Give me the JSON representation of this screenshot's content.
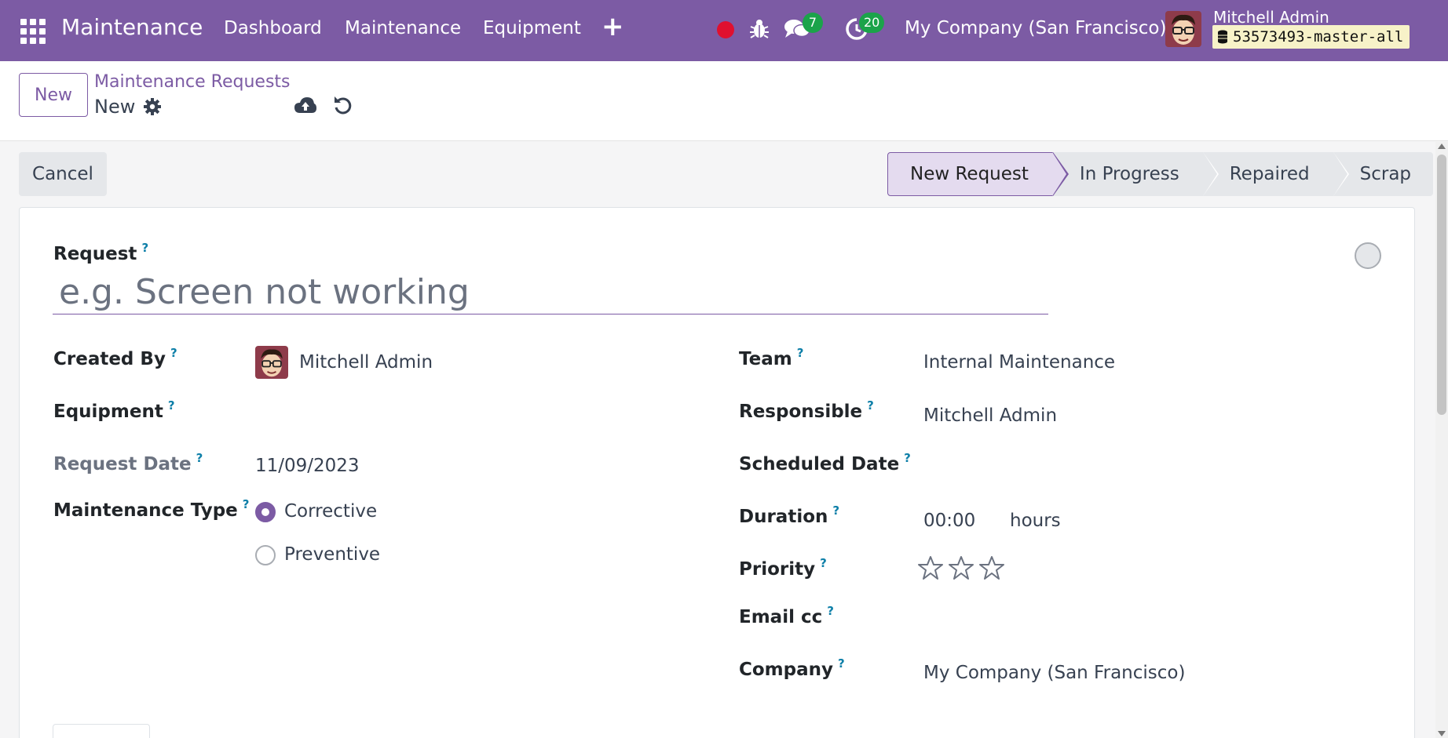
{
  "navbar": {
    "app_name": "Maintenance",
    "menu": [
      "Dashboard",
      "Maintenance",
      "Equipment"
    ],
    "messages_count": "7",
    "activities_count": "20",
    "company": "My Company (San Francisco)",
    "user_name": "Mitchell Admin",
    "database": "53573493-master-all"
  },
  "control_panel": {
    "new_label": "New",
    "breadcrumb_parent": "Maintenance Requests",
    "breadcrumb_current": "New"
  },
  "statusbar": {
    "cancel_label": "Cancel",
    "stages": [
      "New Request",
      "In Progress",
      "Repaired",
      "Scrap"
    ],
    "active_stage": "New Request"
  },
  "form": {
    "request_label": "Request",
    "request_placeholder": "e.g. Screen not working",
    "help_mark": "?",
    "created_by_label": "Created By",
    "created_by_value": "Mitchell Admin",
    "equipment_label": "Equipment",
    "equipment_value": "",
    "request_date_label": "Request Date",
    "request_date_value": "11/09/2023",
    "maintenance_type_label": "Maintenance Type",
    "maintenance_type_options": [
      "Corrective",
      "Preventive"
    ],
    "maintenance_type_selected": "Corrective",
    "team_label": "Team",
    "team_value": "Internal Maintenance",
    "responsible_label": "Responsible",
    "responsible_value": "Mitchell Admin",
    "scheduled_date_label": "Scheduled Date",
    "scheduled_date_value": "",
    "duration_label": "Duration",
    "duration_value": "00:00",
    "duration_unit": "hours",
    "priority_label": "Priority",
    "priority_stars_filled": 0,
    "priority_stars_total": 3,
    "email_cc_label": "Email cc",
    "email_cc_value": "",
    "company_label": "Company",
    "company_value": "My Company (San Francisco)"
  },
  "colors": {
    "brand": "#7c5ba4",
    "badge": "#1ba34a",
    "record_dot": "#e0102f",
    "help_mark": "#0d7fa8"
  }
}
